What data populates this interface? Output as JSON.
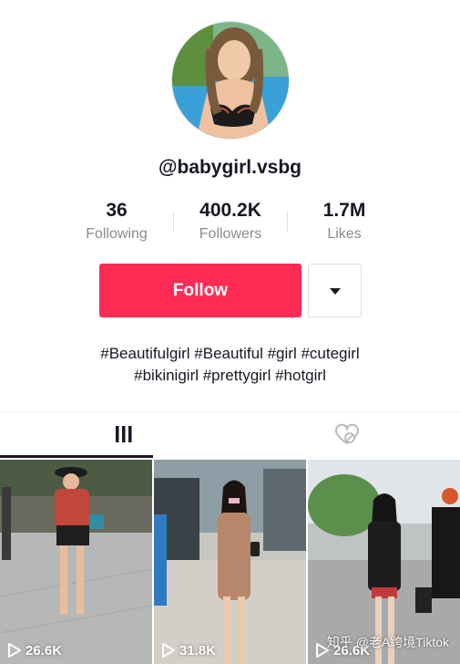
{
  "profile": {
    "username": "@babygirl.vsbg",
    "stats": [
      {
        "value": "36",
        "label": "Following"
      },
      {
        "value": "400.2K",
        "label": "Followers"
      },
      {
        "value": "1.7M",
        "label": "Likes"
      }
    ],
    "follow_label": "Follow",
    "bio_line1": "#Beautifulgirl #Beautiful #girl #cutegirl",
    "bio_line2": "#bikinigirl #prettygirl #hotgirl"
  },
  "tabs": {
    "videos_icon": "grid-icon",
    "liked_icon": "heart-hidden-icon",
    "active": "videos"
  },
  "videos": [
    {
      "views": "26.6K"
    },
    {
      "views": "31.8K"
    },
    {
      "views": "26.6K"
    }
  ],
  "watermark": "知乎 @老A跨境Tiktok",
  "colors": {
    "accent": "#fe2c55",
    "text": "#161823",
    "muted": "#8a8b91"
  }
}
